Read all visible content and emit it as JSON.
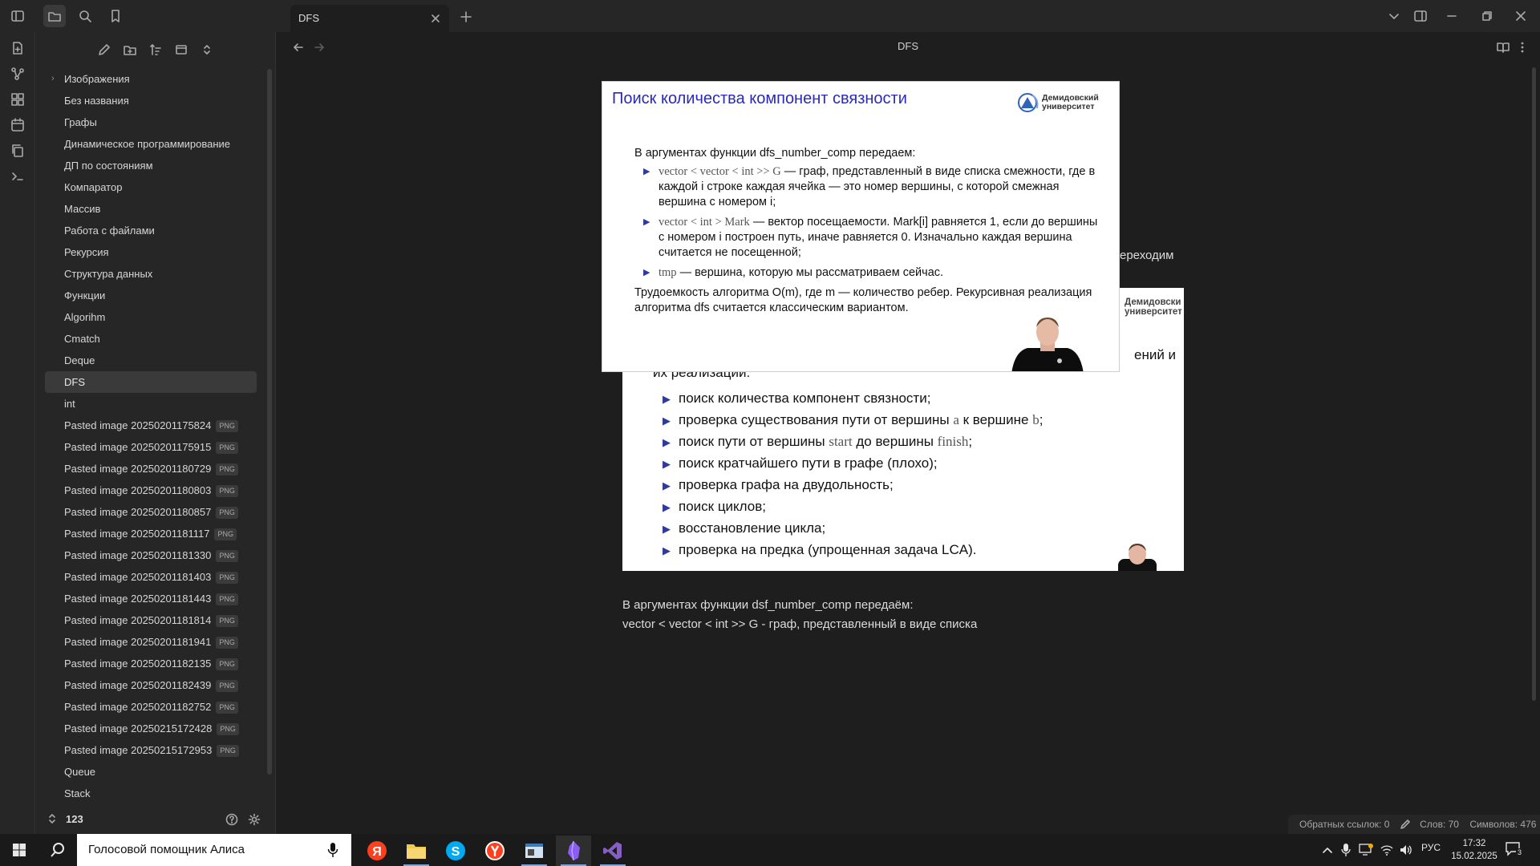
{
  "window": {
    "tab_title": "DFS",
    "view_title": "DFS"
  },
  "sidebar": {
    "items": [
      {
        "label": "Изображения",
        "folder": true
      },
      {
        "label": "Без названия"
      },
      {
        "label": "Графы"
      },
      {
        "label": "Динамическое программирование"
      },
      {
        "label": "ДП по состояниям"
      },
      {
        "label": "Компаратор"
      },
      {
        "label": "Массив"
      },
      {
        "label": "Работа с файлами"
      },
      {
        "label": "Рекурсия"
      },
      {
        "label": "Структура данных"
      },
      {
        "label": "Функции"
      },
      {
        "label": "Algorihm"
      },
      {
        "label": "Cmatch"
      },
      {
        "label": "Deque"
      },
      {
        "label": "DFS",
        "active": true
      },
      {
        "label": "int"
      },
      {
        "label": "Pasted image 20250201175824",
        "badge": "PNG"
      },
      {
        "label": "Pasted image 20250201175915",
        "badge": "PNG"
      },
      {
        "label": "Pasted image 20250201180729",
        "badge": "PNG"
      },
      {
        "label": "Pasted image 20250201180803",
        "badge": "PNG"
      },
      {
        "label": "Pasted image 20250201180857",
        "badge": "PNG"
      },
      {
        "label": "Pasted image 20250201181117",
        "badge": "PNG"
      },
      {
        "label": "Pasted image 20250201181330",
        "badge": "PNG"
      },
      {
        "label": "Pasted image 20250201181403",
        "badge": "PNG"
      },
      {
        "label": "Pasted image 20250201181443",
        "badge": "PNG"
      },
      {
        "label": "Pasted image 20250201181814",
        "badge": "PNG"
      },
      {
        "label": "Pasted image 20250201181941",
        "badge": "PNG"
      },
      {
        "label": "Pasted image 20250201182135",
        "badge": "PNG"
      },
      {
        "label": "Pasted image 20250201182439",
        "badge": "PNG"
      },
      {
        "label": "Pasted image 20250201182752",
        "badge": "PNG"
      },
      {
        "label": "Pasted image 20250215172428",
        "badge": "PNG"
      },
      {
        "label": "Pasted image 20250215172953",
        "badge": "PNG"
      },
      {
        "label": "Queue"
      },
      {
        "label": "Stack"
      }
    ],
    "vault_name": "123"
  },
  "slide_front": {
    "title": "Поиск количества компонент связности",
    "logo_text_1": "Демидовский",
    "logo_text_2": "университет",
    "intro": "В аргументах функции dfs_number_comp передаем:",
    "bullets": [
      {
        "math": "vector < vector < int >> G",
        "text": " — граф, представленный в виде списка смежности, где в каждой i строке каждая ячейка  — это номер вершины, с которой смежная вершина с номером i;"
      },
      {
        "math": "vector < int > Mark",
        "text": " — вектор посещаемости. Mark[i] равняется 1, если до вершины с номером i построен путь, иначе равняется 0. Изначально каждая вершина считается не посещенной;"
      },
      {
        "math": "tmp",
        "text": " — вершина, которую мы рассматриваем сейчас."
      }
    ],
    "outro": "Трудоемкость алгоритма O(m), где m  — количество ребер. Рекурсивная реализация алгоритма dfs считается классическим вариантом."
  },
  "slide_back": {
    "logo_text_1": "Демидовски",
    "logo_text_2": "университет",
    "intro_line_1_tail": "ений и",
    "intro_line_2": "их реализации:",
    "items": [
      {
        "text": "поиск количества компонент связности;"
      },
      {
        "text": "проверка существования пути от вершины ",
        "m1": "a",
        "mid": " к вершине ",
        "m2": "b",
        "end": ";"
      },
      {
        "text": "поиск пути от вершины ",
        "m1": "start",
        "mid": " до вершины ",
        "m2": "finish",
        "end": ";"
      },
      {
        "text": "поиск кратчайшего пути в графе (плохо);"
      },
      {
        "text": "проверка графа на двудольность;"
      },
      {
        "text": "поиск циклов;"
      },
      {
        "text": "восстановление цикла;"
      },
      {
        "text": "проверка на предка (упрощенная задача LCA)."
      }
    ]
  },
  "note": {
    "peek": "ереходим",
    "line1": "В аргументах функции dsf_number_comp передаём:",
    "line2": "vector < vector < int >> G  - граф, представленный в виде списка"
  },
  "status": {
    "backlinks": "Обратных ссылок: 0",
    "words": "Слов: 70",
    "chars": "Символов: 476"
  },
  "taskbar": {
    "search_placeholder": "Голосовой помощник Алиса",
    "lang": "РУС",
    "time": "17:32",
    "date": "15.02.2025",
    "notif_count": "3"
  },
  "colors": {
    "accent_blue": "#2a2ab6",
    "bullet_blue": "#2f3b9c",
    "bg": "#1e1e1e",
    "panel": "#262626"
  }
}
